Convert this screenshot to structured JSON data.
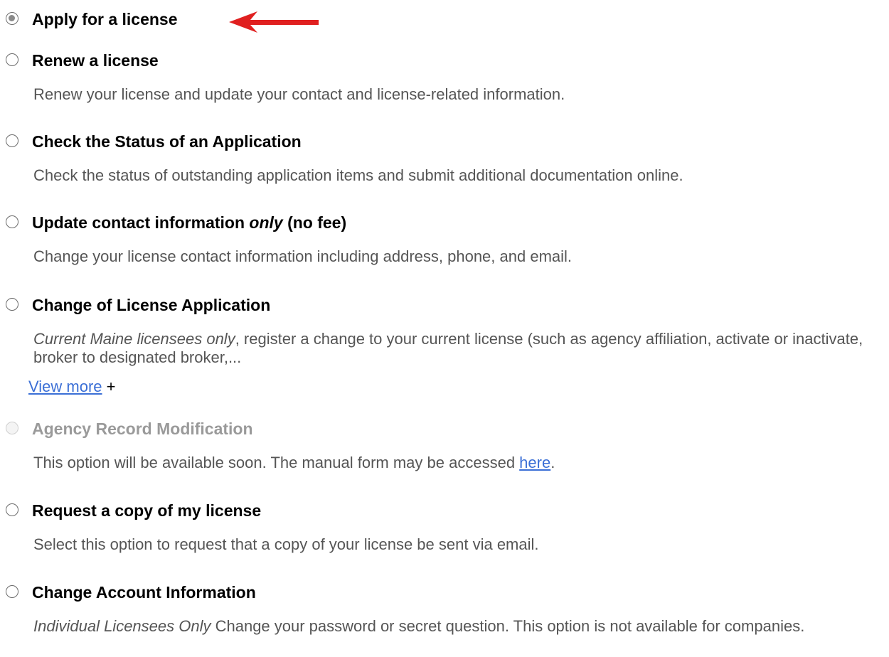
{
  "options": [
    {
      "label": "Apply for a license",
      "selected": true,
      "disabled": false
    },
    {
      "label": "Renew a license",
      "selected": false,
      "disabled": false,
      "description": "Renew your license and update your contact and license-related information."
    },
    {
      "label": "Check the Status of an Application",
      "selected": false,
      "disabled": false,
      "description": "Check the status of outstanding application items and submit additional documentation online."
    },
    {
      "label_pre": "Update contact information ",
      "label_em": "only",
      "label_post": " (no fee)",
      "selected": false,
      "disabled": false,
      "description": "Change your license contact information including address, phone, and email."
    },
    {
      "label": "Change of License Application",
      "selected": false,
      "disabled": false,
      "description_em": "Current Maine licensees only",
      "description": ", register a change to your current license (such as agency affiliation, activate or inactivate, broker to designated broker,...",
      "view_more": "View more",
      "view_more_suffix": " +"
    },
    {
      "label": "Agency Record Modification",
      "selected": false,
      "disabled": true,
      "description": "This option will be available soon. The manual form may be accessed ",
      "link": "here",
      "description_end": "."
    },
    {
      "label": "Request a copy of my license",
      "selected": false,
      "disabled": false,
      "description": "Select this option to request that a copy of your license be sent via email."
    },
    {
      "label": "Change Account Information",
      "selected": false,
      "disabled": false,
      "description_em": "Individual Licensees Only",
      "description": " Change your password or secret question. This option is not available for companies."
    }
  ],
  "colors": {
    "arrow": "#e02020",
    "link": "#3b6fd6"
  }
}
